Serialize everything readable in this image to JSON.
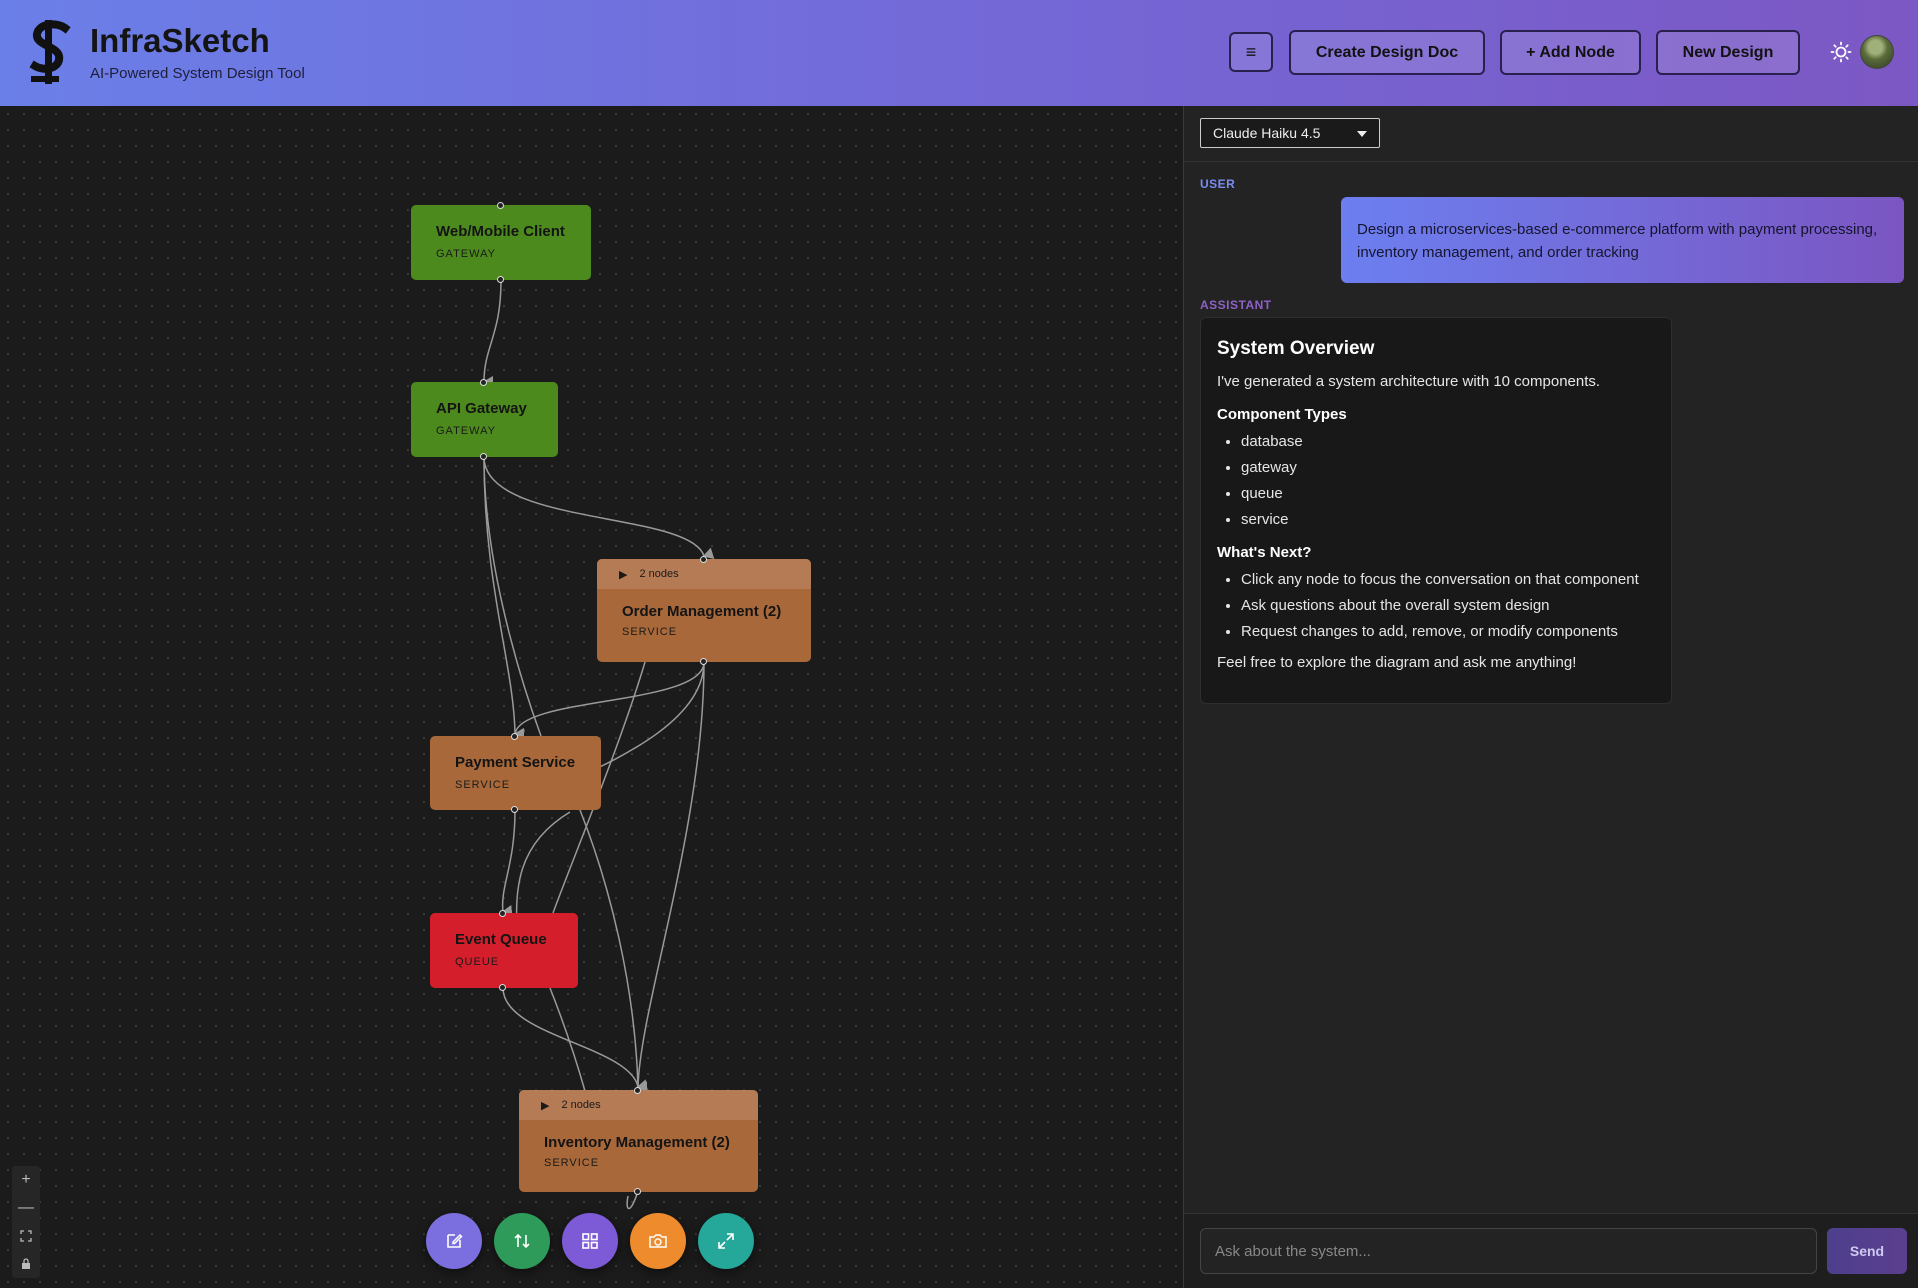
{
  "app": {
    "title": "InfraSketch",
    "subtitle": "AI-Powered System Design Tool"
  },
  "header": {
    "menu_icon": "hamburger-icon",
    "menu_glyph": "≡",
    "create_doc_label": "Create Design Doc",
    "add_node_label": "+ Add Node",
    "new_design_label": "New Design",
    "theme_icon": "sun-icon"
  },
  "diagram": {
    "nodes": [
      {
        "id": "web",
        "label": "Web/Mobile Client",
        "type": "GATEWAY"
      },
      {
        "id": "api",
        "label": "API Gateway",
        "type": "GATEWAY"
      },
      {
        "id": "order",
        "label": "Order Management (2)",
        "type": "SERVICE",
        "group_count": "2 nodes"
      },
      {
        "id": "payment",
        "label": "Payment Service",
        "type": "SERVICE"
      },
      {
        "id": "queue",
        "label": "Event Queue",
        "type": "QUEUE"
      },
      {
        "id": "inventory",
        "label": "Inventory Management (2)",
        "type": "SERVICE",
        "group_count": "2 nodes"
      }
    ],
    "colors": {
      "gateway": "#4d8a1d",
      "service": "#a8683a",
      "queue": "#d51e2c"
    }
  },
  "zoom_controls": {
    "zoom_in": "+",
    "zoom_out": "—"
  },
  "toolbar": [
    {
      "name": "edit-icon",
      "color": "#7b6fe0"
    },
    {
      "name": "sort-icon",
      "color": "#2e9b5a"
    },
    {
      "name": "grid-icon",
      "color": "#7d5ad6"
    },
    {
      "name": "camera-icon",
      "color": "#ee8b2c"
    },
    {
      "name": "expand-icon",
      "color": "#25a79a"
    }
  ],
  "chat": {
    "model": "Claude Haiku 4.5",
    "user_role": "USER",
    "user_message": "Design a microservices-based e-commerce platform with payment processing, inventory management, and order tracking",
    "assistant_role": "ASSISTANT",
    "response": {
      "heading": "System Overview",
      "intro": "I've generated a system architecture with 10 components.",
      "types_heading": "Component Types",
      "types": [
        "database",
        "gateway",
        "queue",
        "service"
      ],
      "next_heading": "What's Next?",
      "next": [
        "Click any node to focus the conversation on that component",
        "Ask questions about the overall system design",
        "Request changes to add, remove, or modify components"
      ],
      "closing": "Feel free to explore the diagram and ask me anything!"
    },
    "input_placeholder": "Ask about the system...",
    "send_label": "Send"
  }
}
